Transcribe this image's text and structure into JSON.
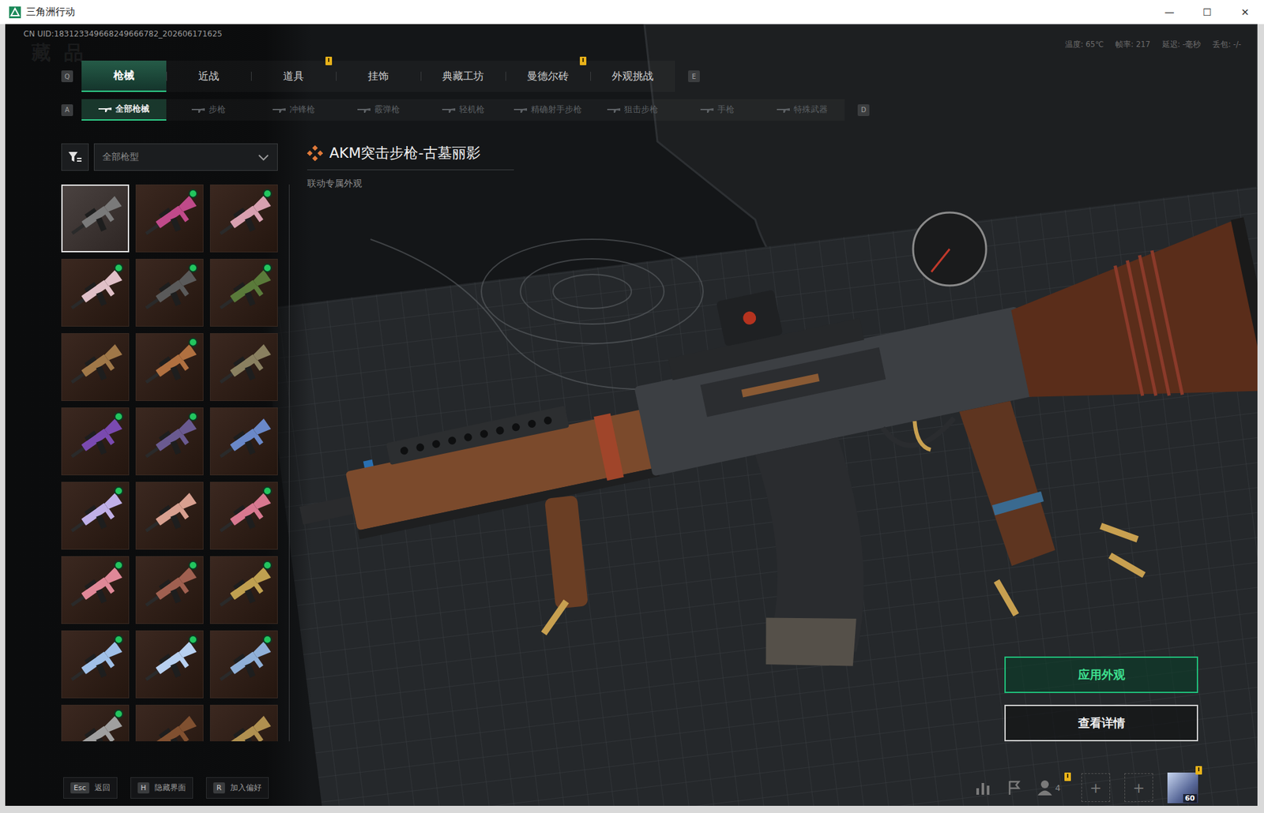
{
  "window": {
    "title": "三角洲行动",
    "controls": [
      "—",
      "☐",
      "✕"
    ]
  },
  "header": {
    "uid": "CN UID:183123349668249666782_202606171625",
    "watermark": "藏品",
    "stats": [
      {
        "label": "温度:",
        "value": "65℃"
      },
      {
        "label": "帧率:",
        "value": "217"
      },
      {
        "label": "延迟:",
        "value": "-毫秒"
      },
      {
        "label": "丢包:",
        "value": "-/-"
      }
    ]
  },
  "main_tabs": {
    "prev_key": "Q",
    "next_key": "E",
    "items": [
      {
        "label": "枪械",
        "selected": true,
        "badge": false
      },
      {
        "label": "近战",
        "selected": false,
        "badge": false
      },
      {
        "label": "道具",
        "selected": false,
        "badge": true
      },
      {
        "label": "挂饰",
        "selected": false,
        "badge": false
      },
      {
        "label": "典藏工坊",
        "selected": false,
        "badge": false
      },
      {
        "label": "曼德尔砖",
        "selected": false,
        "badge": true
      },
      {
        "label": "外观挑战",
        "selected": false,
        "badge": false
      }
    ]
  },
  "sub_tabs": {
    "prev_key": "A",
    "next_key": "D",
    "items": [
      {
        "label": "全部枪械",
        "selected": true
      },
      {
        "label": "步枪",
        "selected": false
      },
      {
        "label": "冲锋枪",
        "selected": false
      },
      {
        "label": "霰弹枪",
        "selected": false
      },
      {
        "label": "轻机枪",
        "selected": false
      },
      {
        "label": "精确射手步枪",
        "selected": false
      },
      {
        "label": "狙击步枪",
        "selected": false
      },
      {
        "label": "手枪",
        "selected": false
      },
      {
        "label": "特殊武器",
        "selected": false
      }
    ]
  },
  "filter": {
    "value": "全部枪型"
  },
  "skins": [
    {
      "selected": true,
      "new": false,
      "color": "#7a7a7a"
    },
    {
      "selected": false,
      "new": true,
      "color": "#c04a8a"
    },
    {
      "selected": false,
      "new": true,
      "color": "#d8a0b0"
    },
    {
      "selected": false,
      "new": true,
      "color": "#e0c0c8"
    },
    {
      "selected": false,
      "new": true,
      "color": "#5a5a5a"
    },
    {
      "selected": false,
      "new": true,
      "color": "#5a7a3a"
    },
    {
      "selected": false,
      "new": false,
      "color": "#a07848"
    },
    {
      "selected": false,
      "new": true,
      "color": "#b07040"
    },
    {
      "selected": false,
      "new": false,
      "color": "#8a8060"
    },
    {
      "selected": false,
      "new": true,
      "color": "#7a4ab0"
    },
    {
      "selected": false,
      "new": true,
      "color": "#6a5a90"
    },
    {
      "selected": false,
      "new": false,
      "color": "#6a88c8"
    },
    {
      "selected": false,
      "new": true,
      "color": "#c0b0e8"
    },
    {
      "selected": false,
      "new": false,
      "color": "#d8a090"
    },
    {
      "selected": false,
      "new": true,
      "color": "#d87890"
    },
    {
      "selected": false,
      "new": true,
      "color": "#e08898"
    },
    {
      "selected": false,
      "new": true,
      "color": "#a06050"
    },
    {
      "selected": false,
      "new": true,
      "color": "#c0a050"
    },
    {
      "selected": false,
      "new": true,
      "color": "#a0c0e8"
    },
    {
      "selected": false,
      "new": true,
      "color": "#b8d0f0"
    },
    {
      "selected": false,
      "new": true,
      "color": "#90b0d8"
    },
    {
      "selected": false,
      "new": true,
      "color": "#a0a0a0"
    },
    {
      "selected": false,
      "new": false,
      "color": "#805030"
    },
    {
      "selected": false,
      "new": false,
      "color": "#b09050"
    }
  ],
  "detail": {
    "title": "AKM突击步枪-古墓丽影",
    "subtitle": "联动专属外观"
  },
  "actions": [
    {
      "label": "应用外观",
      "primary": true
    },
    {
      "label": "查看详情",
      "primary": false
    }
  ],
  "hints": [
    {
      "key": "Esc",
      "label": "返回"
    },
    {
      "key": "H",
      "label": "隐藏界面"
    },
    {
      "key": "R",
      "label": "加入偏好"
    }
  ],
  "toolbar": {
    "friends_count": "4",
    "friends_badge": true,
    "slots": [
      "+",
      "+"
    ],
    "level": "60",
    "avatar_badge": true
  }
}
